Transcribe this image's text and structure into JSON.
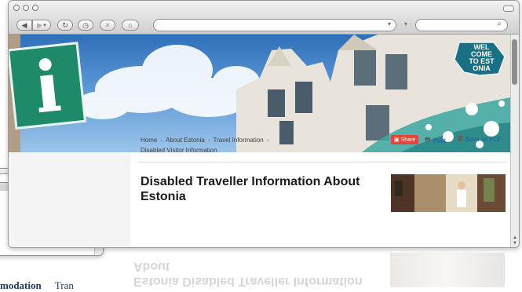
{
  "browser": {
    "nav_icons": [
      "back-arrow-icon",
      "forward-arrow-icon",
      "reload-icon",
      "history-icon",
      "stop-icon",
      "home-icon"
    ],
    "url_value": "",
    "search_value": ""
  },
  "hero": {
    "logo_lines": [
      "WEL",
      "COME",
      "TO EST",
      "ONIA"
    ],
    "info_sign": "i"
  },
  "breadcrumb": {
    "items": [
      "Home",
      "About Estonia",
      "Travel Information",
      "Disabled Visitor Information"
    ]
  },
  "actions": {
    "share": "Share",
    "print": "Print",
    "pdf": "Save as PDF"
  },
  "page": {
    "title": "Disabled Traveller Information About Estonia"
  },
  "reflection": {
    "title": "Estonia Disabled Traveller Information About"
  },
  "back_window": {
    "tabs": [
      "modation",
      "Tran"
    ]
  },
  "colors": {
    "accent_link": "#1f5fa0",
    "share_red": "#e2463a",
    "logo_teal": "#1b6f82"
  }
}
